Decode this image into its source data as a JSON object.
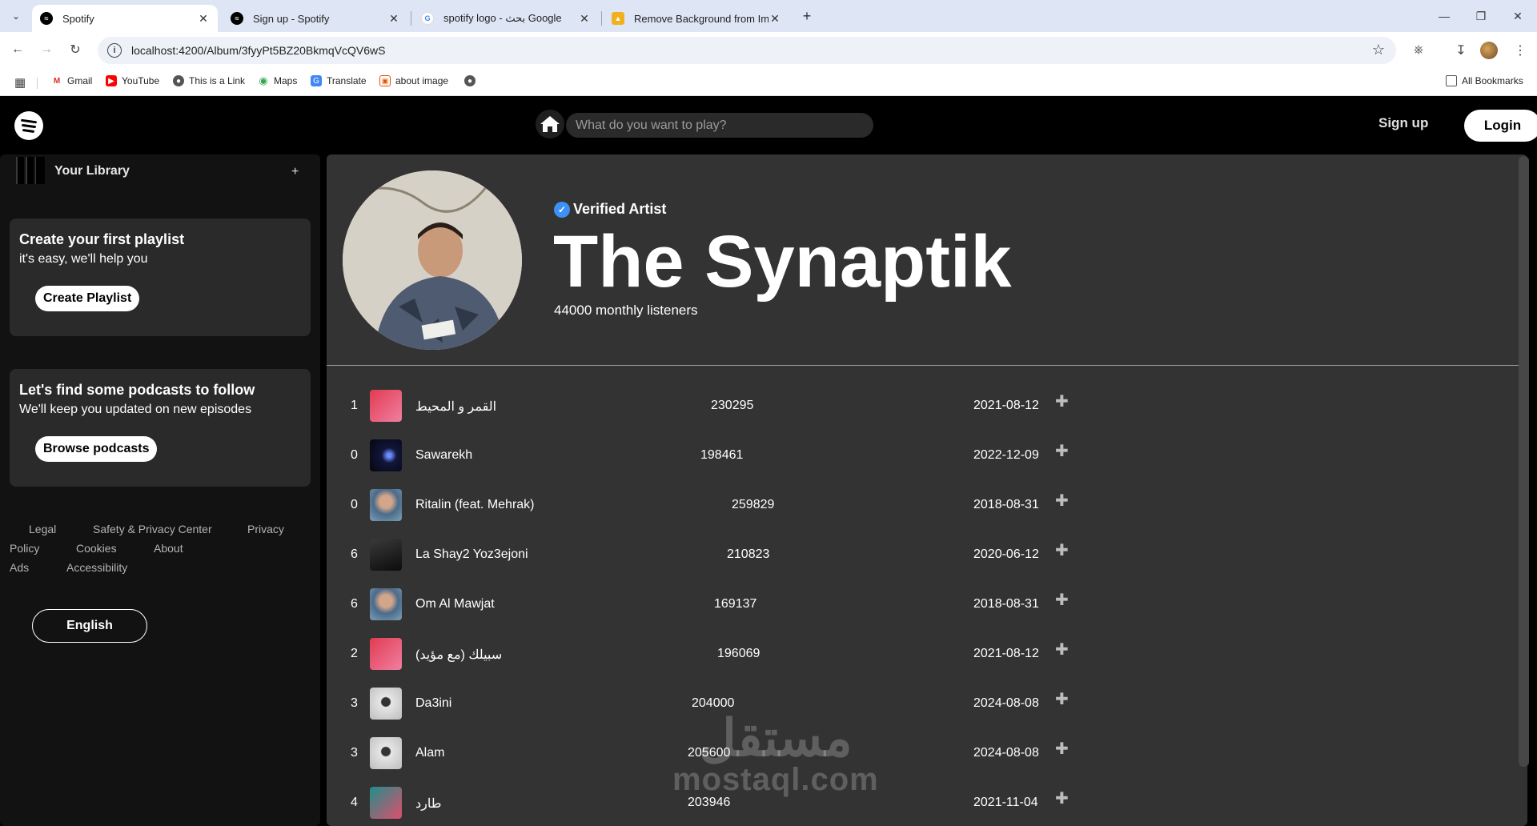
{
  "browser": {
    "tabs": [
      {
        "label": "Spotify",
        "active": true,
        "favicon": "spotify-icon"
      },
      {
        "label": "Sign up - Spotify",
        "active": false,
        "favicon": "spotify-icon"
      },
      {
        "label": "spotify logo - بحث Google",
        "active": false,
        "favicon": "google-icon"
      },
      {
        "label": "Remove Background from Imag",
        "active": false,
        "favicon": "removebg-icon"
      }
    ],
    "url": "localhost:4200/Album/3fyyPt5BZ20BkmqVcQV6wS",
    "bookmarks": [
      {
        "label": "Gmail",
        "icon": "gmail-icon"
      },
      {
        "label": "YouTube",
        "icon": "youtube-icon"
      },
      {
        "label": "This is a Link",
        "icon": "globe-icon"
      },
      {
        "label": "Maps",
        "icon": "maps-icon"
      },
      {
        "label": "Translate",
        "icon": "translate-icon"
      },
      {
        "label": "about image",
        "icon": "image-icon"
      }
    ],
    "all_bookmarks": "All Bookmarks"
  },
  "topbar": {
    "search_placeholder": "What do you want to play?",
    "signup": "Sign up",
    "login": "Login"
  },
  "sidebar": {
    "library_title": "Your Library",
    "plus": "+",
    "playlist_card": {
      "title": "Create your first playlist",
      "subtitle": "it's easy, we'll help you",
      "button": "Create Playlist"
    },
    "podcast_card": {
      "title": "Let's find some podcasts to follow",
      "subtitle": "We'll keep you updated on new episodes",
      "button": "Browse podcasts"
    },
    "legal_links": [
      "Legal",
      "Safety & Privacy Center",
      "Privacy",
      "Policy",
      "Cookies",
      "About",
      "Ads",
      "Accessibility"
    ],
    "language": "English"
  },
  "artist": {
    "verified": "Verified Artist",
    "name": "The Synaptik",
    "listeners": "44000 monthly listeners"
  },
  "tracks": [
    {
      "rank": "1",
      "name": "القمر و المحيط",
      "plays": "230295",
      "date": "2021-08-12",
      "thumb": "red"
    },
    {
      "rank": "0",
      "name": "Sawarekh",
      "plays": "198461",
      "date": "2022-12-09",
      "thumb": "space"
    },
    {
      "rank": "0",
      "name": "Ritalin (feat. Mehrak)",
      "plays": "259829",
      "date": "2018-08-31",
      "thumb": "portrait"
    },
    {
      "rank": "6",
      "name": "La Shay2 Yoz3ejoni",
      "plays": "210823",
      "date": "2020-06-12",
      "thumb": "dark"
    },
    {
      "rank": "6",
      "name": "Om Al Mawjat",
      "plays": "169137",
      "date": "2018-08-31",
      "thumb": "portrait"
    },
    {
      "rank": "2",
      "name": "سبيلك (مع مؤيد)",
      "plays": "196069",
      "date": "2021-08-12",
      "thumb": "red"
    },
    {
      "rank": "3",
      "name": "Da3ini",
      "plays": "204000",
      "date": "2024-08-08",
      "thumb": "light"
    },
    {
      "rank": "3",
      "name": "Alam",
      "plays": "205600",
      "date": "2024-08-08",
      "thumb": "light"
    },
    {
      "rank": "4",
      "name": "طارد",
      "plays": "203946",
      "date": "2021-11-04",
      "thumb": "teal"
    }
  ],
  "watermark": {
    "arabic": "مستقل",
    "latin": "mostaql.com"
  },
  "colors": {
    "accent_blue": "#3d91f4",
    "main_bg": "#333333",
    "sidebar_bg": "#121212"
  }
}
